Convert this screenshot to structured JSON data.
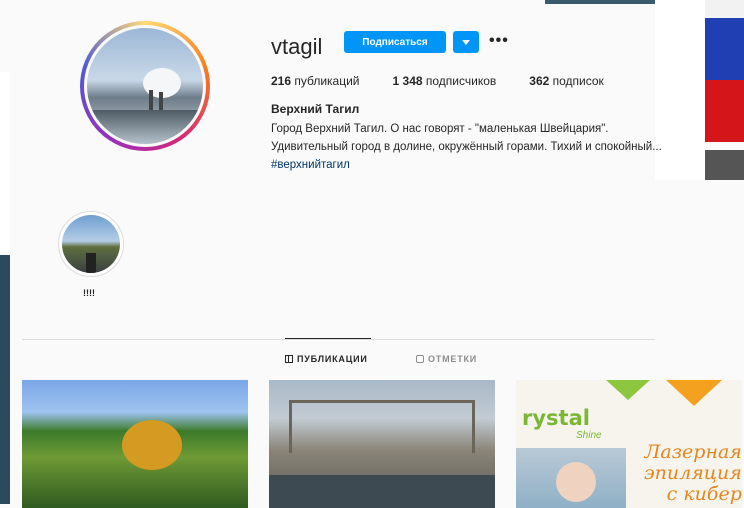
{
  "profile": {
    "username": "vtagil",
    "follow_label": "Подписаться",
    "more_icon": "•••",
    "stats": [
      {
        "count": "216",
        "label": "публикаций"
      },
      {
        "count": "1 348",
        "label": "подписчиков"
      },
      {
        "count": "362",
        "label": "подписок"
      }
    ],
    "full_name": "Верхний Тагил",
    "bio_line1": "Город Верхний Тагил. О нас говорят - \"маленькая Швейцария\".",
    "bio_line2": "Удивительный город в долине, окружённый горами. Тихий и спокойный...",
    "hashtag": "#верхнийтагил"
  },
  "highlights": [
    {
      "label": "!!!!"
    }
  ],
  "tabs": [
    {
      "label": "ПУБЛИКАЦИИ",
      "icon": "grid-icon",
      "active": true
    },
    {
      "label": "ОТМЕТКИ",
      "icon": "tag-icon",
      "active": false
    }
  ],
  "posts": [
    {
      "image": "autumn-trees"
    },
    {
      "image": "dam-structure"
    },
    {
      "image": "crystal-shine-ad",
      "brand": "rystal",
      "brand_sub": "Shine",
      "promo_line1": "Лазерная",
      "promo_line2": "эпиляция",
      "promo_line3": "с кибер"
    }
  ],
  "colors": {
    "accent": "#0095f6",
    "text": "#262626",
    "muted": "#8e8e8e",
    "link": "#00376b"
  }
}
